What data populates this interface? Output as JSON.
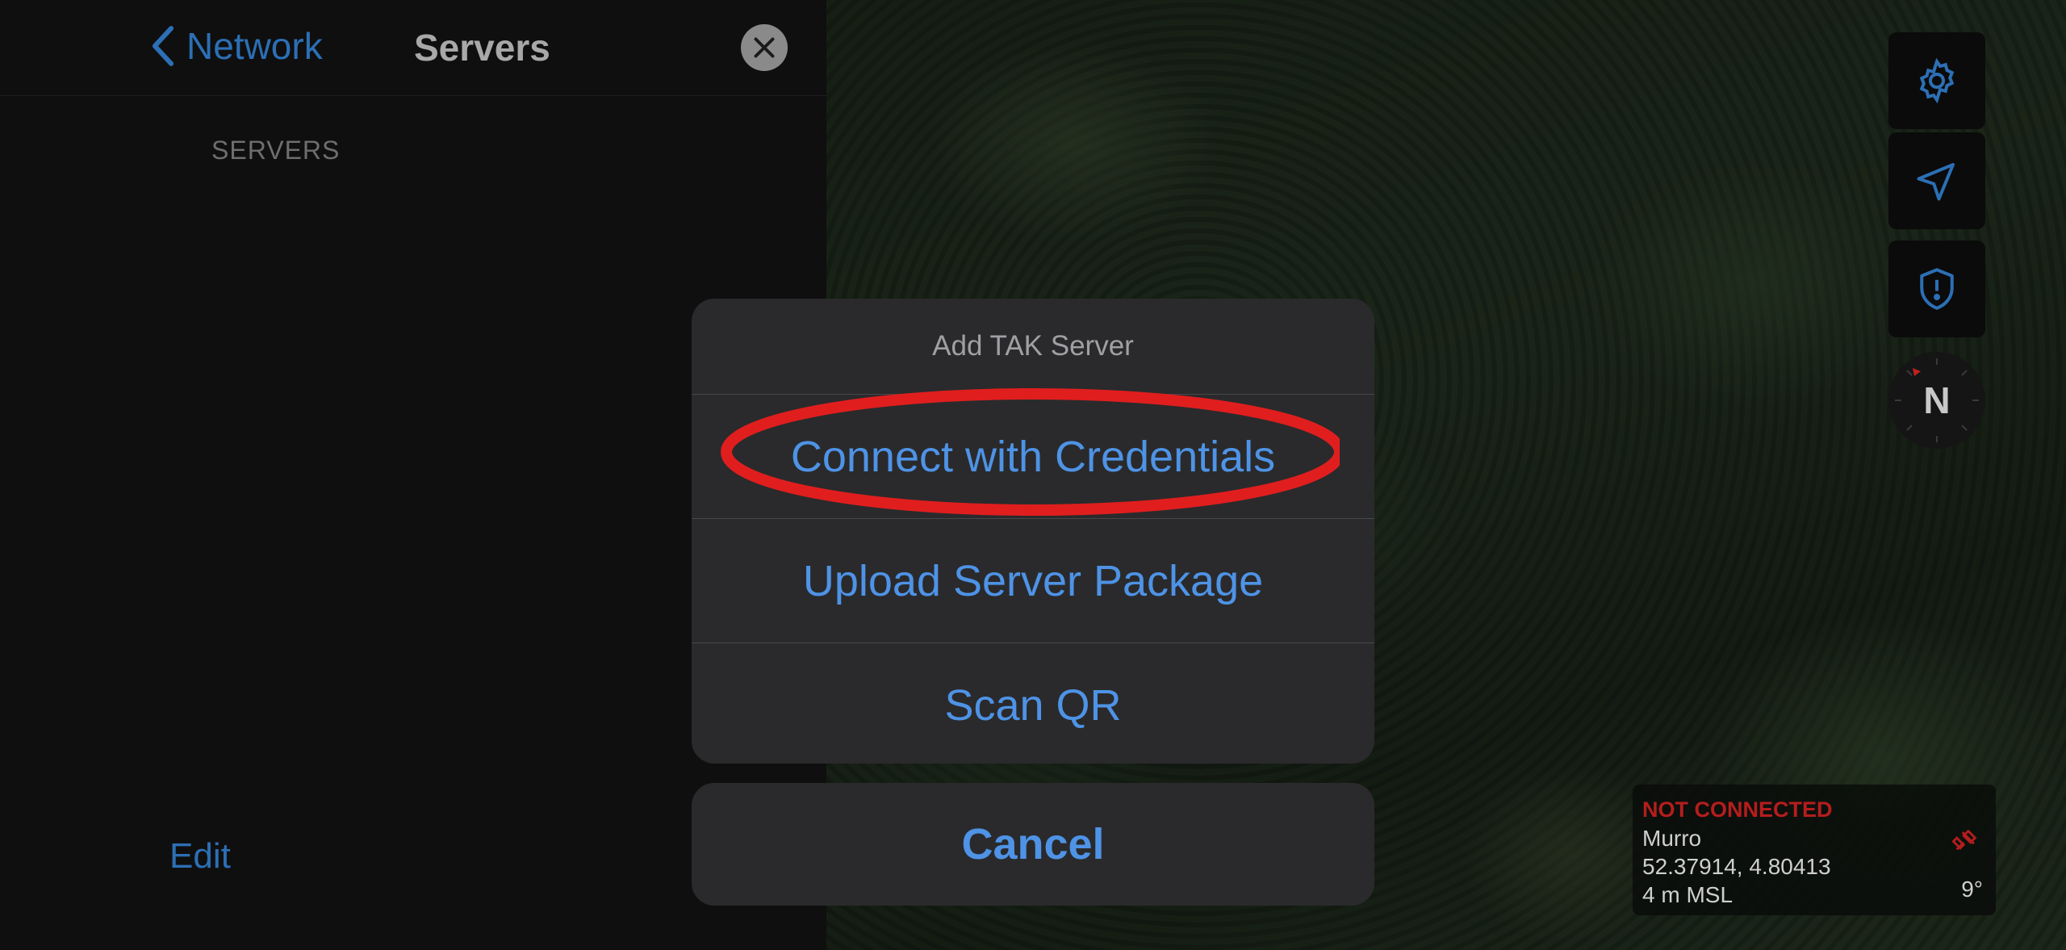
{
  "nav": {
    "back_label": "Network",
    "title": "Servers"
  },
  "list": {
    "section_header": "SERVERS"
  },
  "footer": {
    "edit_label": "Edit"
  },
  "action_sheet": {
    "title": "Add TAK Server",
    "options": [
      {
        "label": "Connect with Credentials"
      },
      {
        "label": "Upload Server Package"
      },
      {
        "label": "Scan QR"
      }
    ],
    "cancel_label": "Cancel"
  },
  "map_controls": {
    "icons": [
      "gear-icon",
      "location-arrow-icon",
      "shield-alert-icon"
    ],
    "compass_label": "N"
  },
  "status": {
    "connection": "NOT CONNECTED",
    "callsign": "Murro",
    "coordinates": "52.37914, 4.80413",
    "altitude": "4 m MSL",
    "heading": "9°"
  },
  "colors": {
    "accent": "#4e93e6",
    "nav_link": "#2c6fb5",
    "error": "#b51d1d",
    "highlight": "#e01e1e"
  }
}
